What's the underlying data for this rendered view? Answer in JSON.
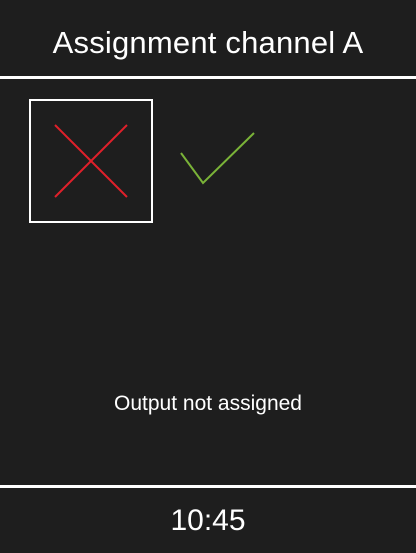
{
  "header": {
    "title": "Assignment channel A"
  },
  "options": [
    {
      "name": "not-assigned",
      "icon": "cross-icon",
      "color": "#e0202a",
      "selected": true
    },
    {
      "name": "assigned",
      "icon": "checkmark-icon",
      "color": "#7ab338",
      "selected": false
    }
  ],
  "status": {
    "text": "Output not assigned"
  },
  "footer": {
    "time": "10:45"
  },
  "colors": {
    "background": "#1e1e1e",
    "foreground": "#ffffff",
    "cross": "#e0202a",
    "check": "#7ab338"
  }
}
